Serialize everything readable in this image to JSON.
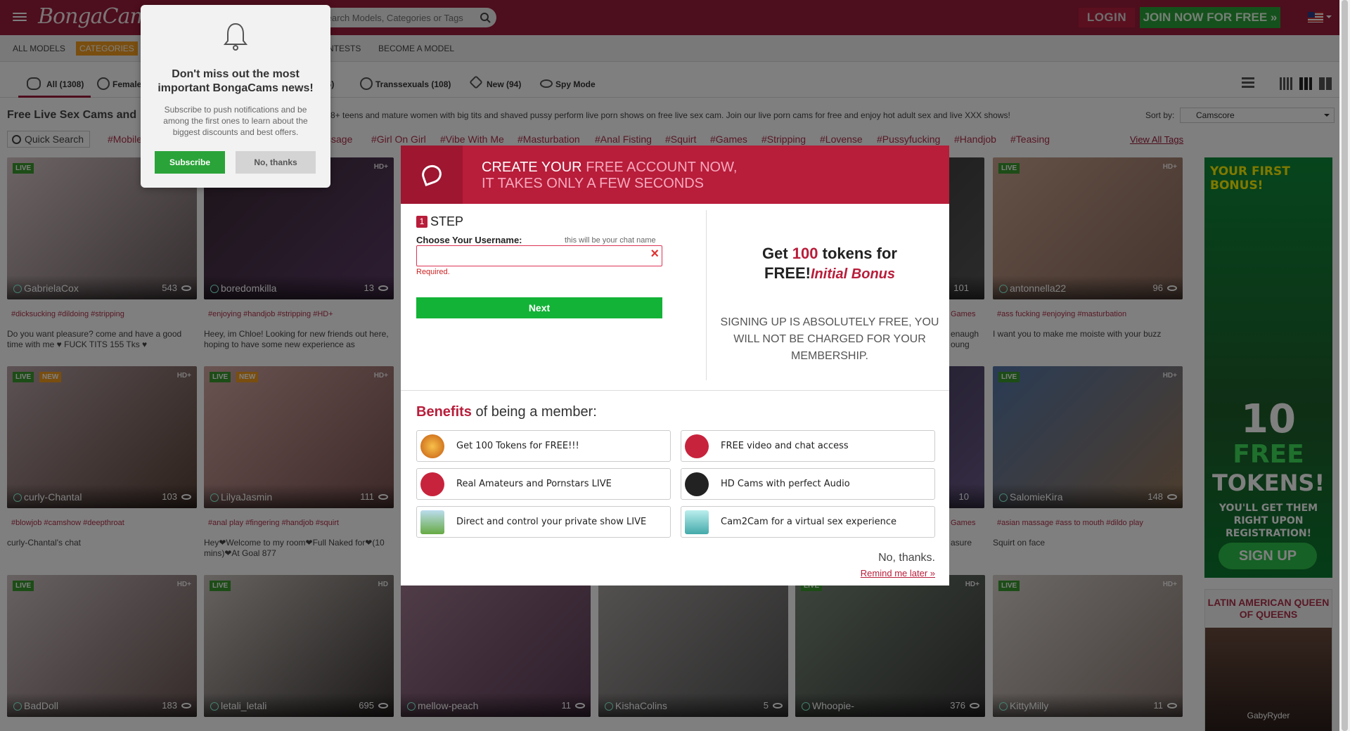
{
  "header": {
    "search_placeholder": "Search Models, Categories or Tags",
    "login": "LOGIN",
    "join": "JOIN NOW FOR FREE »"
  },
  "nav": [
    "ALL MODELS",
    "CATEGORIES",
    "CONTESTS",
    "BECOME A MODEL"
  ],
  "tabs": [
    "All (1308)",
    "Female",
    "16)",
    "Transsexuals (108)",
    "New (94)",
    "Spy Mode"
  ],
  "page_title": "Free Live Sex Cams and",
  "page_desc": "8+ teens and mature women with big tits and shaved pussy perform live porn shows on free live sex cam. Join our live porn cams for free and enjoy hot adult sex and live XXX shows!",
  "sort": {
    "label": "Sort by:",
    "value": "Camscore"
  },
  "quick_search": "Quick Search",
  "top_tags": [
    "#Mobile",
    "ssage",
    "#Girl On Girl",
    "#Vibe With Me",
    "#Masturbation",
    "#Anal Fisting",
    "#Squirt",
    "#Games",
    "#Stripping",
    "#Lovense",
    "#Pussyfucking",
    "#Handjob",
    "#Teasing"
  ],
  "view_all_tags": "View All Tags",
  "cards": [
    {
      "name": "GabrielaCox",
      "count": "543",
      "live": "LIVE",
      "new": "",
      "hd": "",
      "tags": "#dicksucking   #dildoing   #stripping",
      "desc": "Do you want pleasure? come and have a good time with me ♥ FUCK TITS 155 Tks ♥"
    },
    {
      "name": "boredomkilla",
      "count": "13",
      "live": "",
      "new": "",
      "hd": "HD+",
      "tags": "#enjoying   #handjob   #stripping   #HD+",
      "desc": "Heey, im Chloe! Looking for new friends out here, hoping to have some new experience as"
    },
    {
      "name": "antonnella22",
      "count": "96",
      "live": "LIVE",
      "new": "",
      "hd": "HD+",
      "tags": "#ass fucking   #enjoying   #masturbation",
      "desc": "I want you to make me moiste with your buzz"
    },
    {
      "name": "curly-Chantal",
      "count": "103",
      "live": "LIVE",
      "new": "NEW",
      "hd": "HD+",
      "tags": "#blowjob   #camshow   #deepthroat",
      "desc": "curly-Chantal's chat"
    },
    {
      "name": "LilyaJasmin",
      "count": "111",
      "live": "LIVE",
      "new": "NEW",
      "hd": "HD+",
      "tags": "#anal play   #fingering   #handjob   #squirt",
      "desc": "Hey❤Welcome to my room❤Full Naked for❤(10 mins)❤At Goal 877"
    },
    {
      "name": "SalomieKira",
      "count": "148",
      "live": "LIVE",
      "new": "",
      "hd": "HD+",
      "tags": "#asian massage   #ass to mouth   #dildo play",
      "desc": "Squirt on face"
    },
    {
      "name": "BadDoll",
      "count": "183",
      "live": "LIVE",
      "new": "",
      "hd": "HD+",
      "tags": "",
      "desc": ""
    },
    {
      "name": "letali_letali",
      "count": "695",
      "live": "LIVE",
      "new": "",
      "hd": "HD",
      "tags": "",
      "desc": ""
    },
    {
      "name": "mellow-peach",
      "count": "11",
      "live": "",
      "new": "",
      "hd": "",
      "tags": "",
      "desc": ""
    },
    {
      "name": "KishaColins",
      "count": "5",
      "live": "",
      "new": "",
      "hd": "",
      "tags": "",
      "desc": ""
    },
    {
      "name": "Whoopie-",
      "count": "376",
      "live": "LIVE",
      "new": "",
      "hd": "HD+",
      "tags": "",
      "desc": ""
    },
    {
      "name": "KittyMilly",
      "count": "11",
      "live": "LIVE",
      "new": "",
      "hd": "HD+",
      "tags": "",
      "desc": ""
    }
  ],
  "partial": {
    "count1": "101",
    "count2": "10",
    "tag1": "Games",
    "tag2": "Games",
    "desc1": "enaugh",
    "desc2": "oung",
    "desc3": "asure"
  },
  "promo": {
    "title": "YOUR FIRST BONUS!",
    "big1": "10",
    "big2": "FREE",
    "big3": "TOKENS!",
    "sub": "YOU'LL GET THEM RIGHT UPON REGISTRATION!",
    "button": "SIGN UP"
  },
  "latam": {
    "title": "LATIN AMERICAN QUEEN OF QUEENS",
    "name": "GabyRyder"
  },
  "push": {
    "title": "Don't miss out the most important BongaCams news!",
    "desc": "Subscribe to push notifications and be among the first ones to learn about the biggest discounts and best offers.",
    "subscribe": "Subscribe",
    "no": "No, thanks"
  },
  "modal": {
    "head1": "CREATE YOUR ",
    "head1b": "FREE ACCOUNT NOW,",
    "head2": "IT TAKES ONLY A FEW SECONDS",
    "step_num": "1",
    "step": "STEP",
    "username_label": "Choose Your Username:",
    "username_hint": "this will be your chat name",
    "required": "Required.",
    "next": "Next",
    "get1": "Get ",
    "get_num": "100",
    "get2": " tokens for",
    "get3": "FREE!",
    "get_bonus": "Initial Bonus",
    "free_text": "SIGNING UP IS ABSOLUTELY FREE, YOU WILL NOT BE CHARGED FOR YOUR MEMBERSHIP.",
    "benefits_a": "Benefits",
    "benefits_b": " of being a member:",
    "benefits": [
      "Get 100 Tokens for FREE!!!",
      "FREE video and chat access",
      "Real Amateurs and Pornstars LIVE",
      "HD Cams with perfect Audio",
      "Direct and control your private show LIVE",
      "Cam2Cam for a virtual sex experience"
    ],
    "no_thanks": "No, thanks.",
    "remind": "Remind me later »"
  }
}
